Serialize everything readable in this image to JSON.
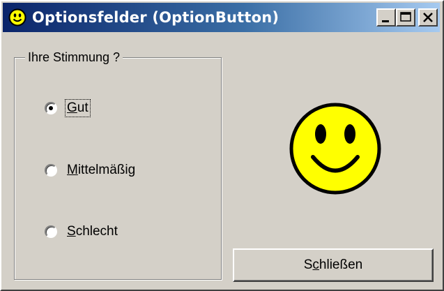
{
  "window": {
    "title": "Optionsfelder (OptionButton)",
    "icon": "smiley-icon",
    "controls": [
      "minimize-icon",
      "maximize-icon",
      "close-icon"
    ]
  },
  "group": {
    "label": "Ihre Stimmung ?",
    "options": [
      {
        "pre": "",
        "ul": "G",
        "post": "ut",
        "selected": true
      },
      {
        "pre": "",
        "ul": "M",
        "post": "ittelmäßig",
        "selected": false
      },
      {
        "pre": "",
        "ul": "S",
        "post": "chlecht",
        "selected": false
      }
    ]
  },
  "display": {
    "icon": "happy-smiley-icon",
    "face_color": "#ffff00"
  },
  "close_button": {
    "pre": "S",
    "ul": "c",
    "post": "hließen"
  },
  "colors": {
    "titlebar_start": "#0a246a",
    "titlebar_end": "#a6caf0",
    "face": "#d4d0c8"
  }
}
